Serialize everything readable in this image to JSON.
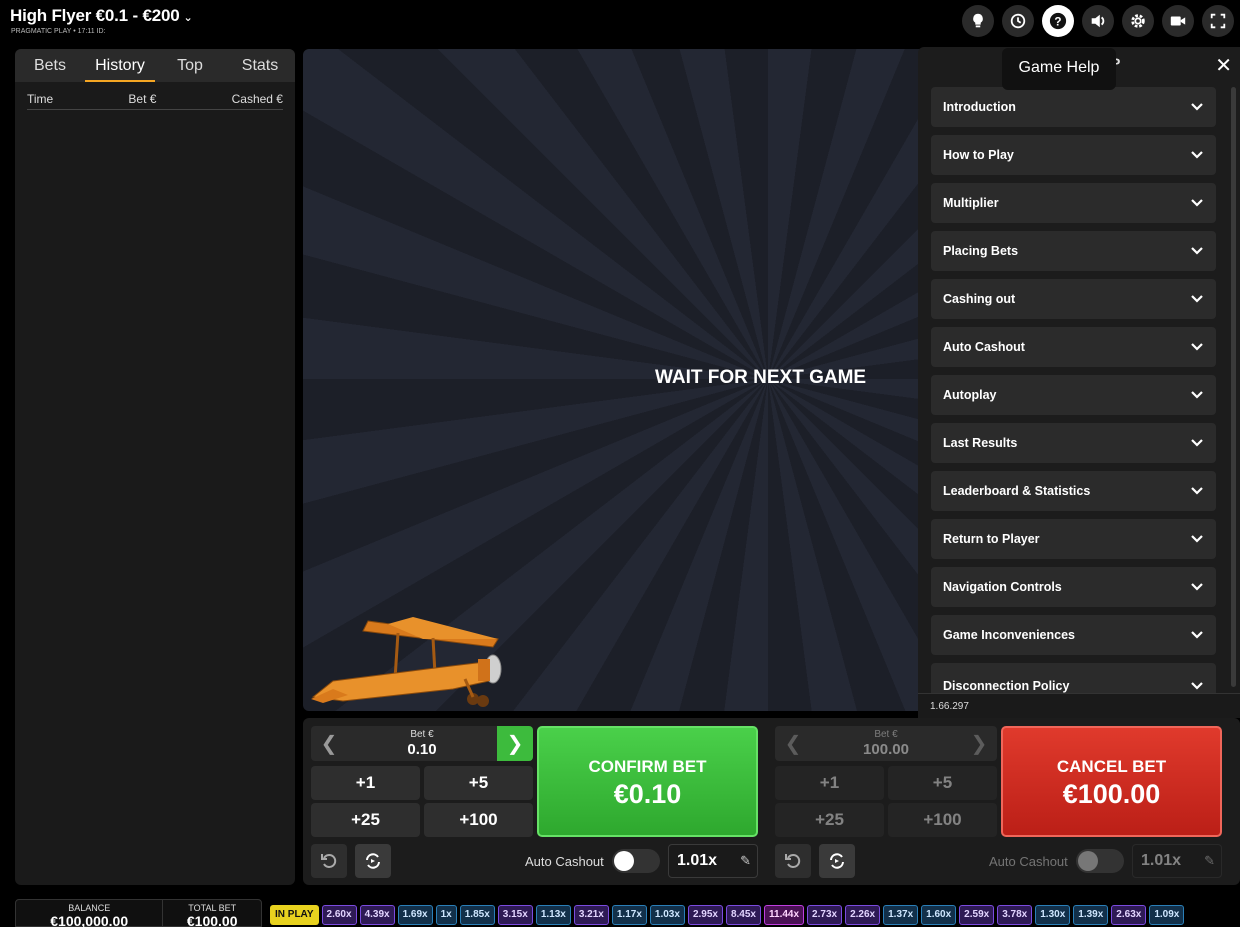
{
  "header": {
    "title": "High Flyer €0.1 - €200",
    "subtitle": "PRAGMATIC PLAY • 17:11 ID:",
    "icons": [
      "bulb-icon",
      "history-icon",
      "help-icon",
      "sound-icon",
      "settings-icon",
      "video-icon",
      "fullscreen-icon"
    ]
  },
  "tooltip": "Game Help",
  "left_panel": {
    "tabs": [
      "Bets",
      "History",
      "Top",
      "Stats"
    ],
    "active_tab": "History",
    "columns": [
      "Time",
      "Bet €",
      "Cashed €"
    ]
  },
  "game": {
    "message": "WAIT FOR NEXT GAME"
  },
  "help": {
    "title_peek": "P",
    "items": [
      "Introduction",
      "How to Play",
      "Multiplier",
      "Placing Bets",
      "Cashing out",
      "Auto Cashout",
      "Autoplay",
      "Last Results",
      "Leaderboard & Statistics",
      "Return to Player",
      "Navigation Controls",
      "Game Inconveniences",
      "Disconnection Policy"
    ],
    "version": "1.66.297"
  },
  "bet1": {
    "label": "Bet €",
    "value": "0.10",
    "quick": [
      "+1",
      "+5",
      "+25",
      "+100"
    ],
    "action_line1": "CONFIRM BET",
    "action_line2": "€0.10",
    "auto_cashout_label": "Auto Cashout",
    "auto_cashout_value": "1.01x"
  },
  "bet2": {
    "label": "Bet €",
    "value": "100.00",
    "quick": [
      "+1",
      "+5",
      "+25",
      "+100"
    ],
    "action_line1": "CANCEL BET",
    "action_line2": "€100.00",
    "auto_cashout_label": "Auto Cashout",
    "auto_cashout_value": "1.01x"
  },
  "footer": {
    "balance_label": "BALANCE",
    "balance_value": "€100,000.00",
    "total_bet_label": "TOTAL BET",
    "total_bet_value": "€100.00",
    "in_play": "IN PLAY",
    "results": [
      "2.60x",
      "4.39x",
      "1.69x",
      "1x",
      "1.85x",
      "3.15x",
      "1.13x",
      "3.21x",
      "1.17x",
      "1.03x",
      "2.95x",
      "8.45x",
      "11.44x",
      "2.73x",
      "2.26x",
      "1.37x",
      "1.60x",
      "2.59x",
      "3.78x",
      "1.30x",
      "1.39x",
      "2.63x",
      "1.09x"
    ],
    "result_colors": [
      "purple",
      "purple",
      "blue",
      "blue",
      "blue",
      "purple",
      "blue",
      "purple",
      "blue",
      "blue",
      "purple",
      "purple",
      "magenta",
      "purple",
      "purple",
      "blue",
      "blue",
      "purple",
      "purple",
      "blue",
      "blue",
      "purple",
      "blue"
    ]
  }
}
